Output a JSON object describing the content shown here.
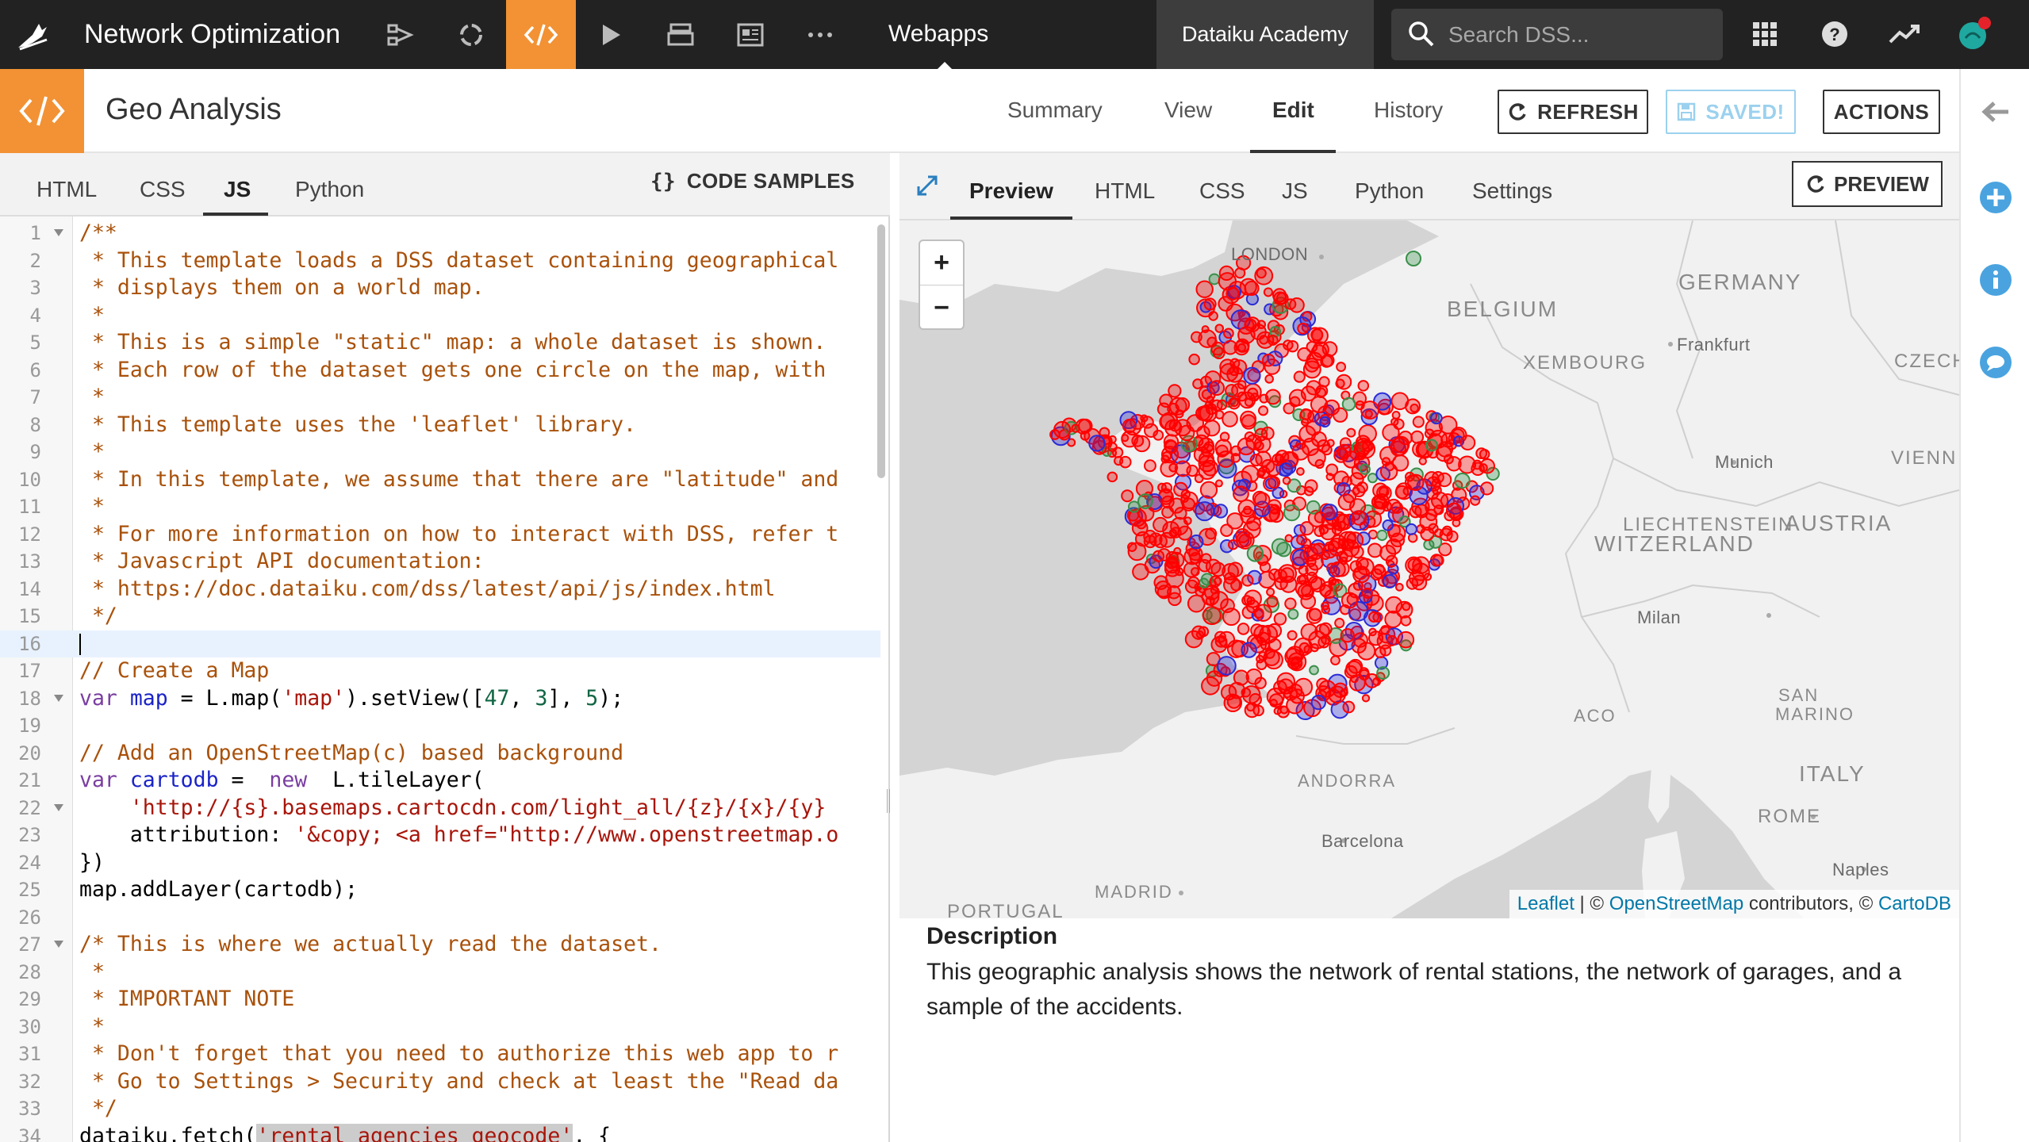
{
  "topbar": {
    "project_name": "Network Optimization",
    "section_label": "Webapps",
    "academy_label": "Dataiku Academy",
    "search_placeholder": "Search DSS...",
    "accent_color": "#f29234"
  },
  "header": {
    "title": "Geo Analysis",
    "tabs": [
      "Summary",
      "View",
      "Edit",
      "History"
    ],
    "active_tab": "Edit",
    "refresh_label": "REFRESH",
    "saved_label": "SAVED!",
    "actions_label": "ACTIONS"
  },
  "editor": {
    "tabs": [
      "HTML",
      "CSS",
      "JS",
      "Python"
    ],
    "active_tab": "JS",
    "code_samples_label": "CODE SAMPLES",
    "lines": [
      "/**",
      " * This template loads a DSS dataset containing geographical",
      " * displays them on a world map.",
      " *",
      " * This is a simple \"static\" map: a whole dataset is shown.",
      " * Each row of the dataset gets one circle on the map, with",
      " *",
      " * This template uses the 'leaflet' library.",
      " *",
      " * In this template, we assume that there are \"latitude\" and",
      " *",
      " * For more information on how to interact with DSS, refer t",
      " * Javascript API documentation:",
      " * https://doc.dataiku.com/dss/latest/api/js/index.html",
      " */",
      "",
      "// Create a Map",
      "var map = L.map('map').setView([47, 3], 5);",
      "",
      "// Add an OpenStreetMap(c) based background",
      "var cartodb =  new  L.tileLayer(",
      "    'http://{s}.basemaps.cartocdn.com/light_all/{z}/{x}/{y}",
      "    attribution: '&copy; <a href=\"http://www.openstreetmap.o",
      "})",
      "map.addLayer(cartodb);",
      "",
      "/* This is where we actually read the dataset.",
      " *",
      " * IMPORTANT NOTE",
      " *",
      " * Don't forget that you need to authorize this web app to r",
      " * Go to Settings > Security and check at least the \"Read da",
      " */",
      "dataiku.fetch('rental_agencies_geocode', {"
    ],
    "fold_lines": [
      1,
      18,
      22,
      27
    ],
    "current_line": 16
  },
  "preview": {
    "tabs": [
      "Preview",
      "HTML",
      "CSS",
      "JS",
      "Python",
      "Settings"
    ],
    "active_tab": "Preview",
    "preview_button_label": "PREVIEW"
  },
  "map": {
    "zoom_in": "+",
    "zoom_out": "−",
    "labels": {
      "london": "LONDON",
      "germany": "GERMANY",
      "belgium": "BELGIUM",
      "luxembourg": "XEMBOURG",
      "frankfurt": "Frankfurt",
      "czech": "CZECH",
      "munich": "Munich",
      "vienna": "VIENN",
      "liechtenstein": "LIECHTENSTEIN",
      "austria": "AUSTRIA",
      "switzerland": "WITZERLAND",
      "milan": "Milan",
      "monaco": "ACO",
      "san_marino_1": "SAN",
      "san_marino_2": "MARINO",
      "andorra": "ANDORRA",
      "italy": "ITALY",
      "rome": "ROME",
      "barcelona": "Barcelona",
      "madrid": "MADRID",
      "naples": "Naples",
      "portugal": "PORTUGAL"
    },
    "attribution_leaflet": "Leaflet",
    "attribution_sep": " | © ",
    "attribution_osm": "OpenStreetMap",
    "attribution_mid": " contributors, © ",
    "attribution_carto": "CartoDB",
    "series_colors": {
      "rental_stations": "#ff0000",
      "garages": "#2b2bd6",
      "accidents": "#3a8f4a"
    }
  },
  "description": {
    "heading": "Description",
    "text": "This geographic analysis shows the network of rental stations, the network of garages, and a sample of the accidents."
  }
}
